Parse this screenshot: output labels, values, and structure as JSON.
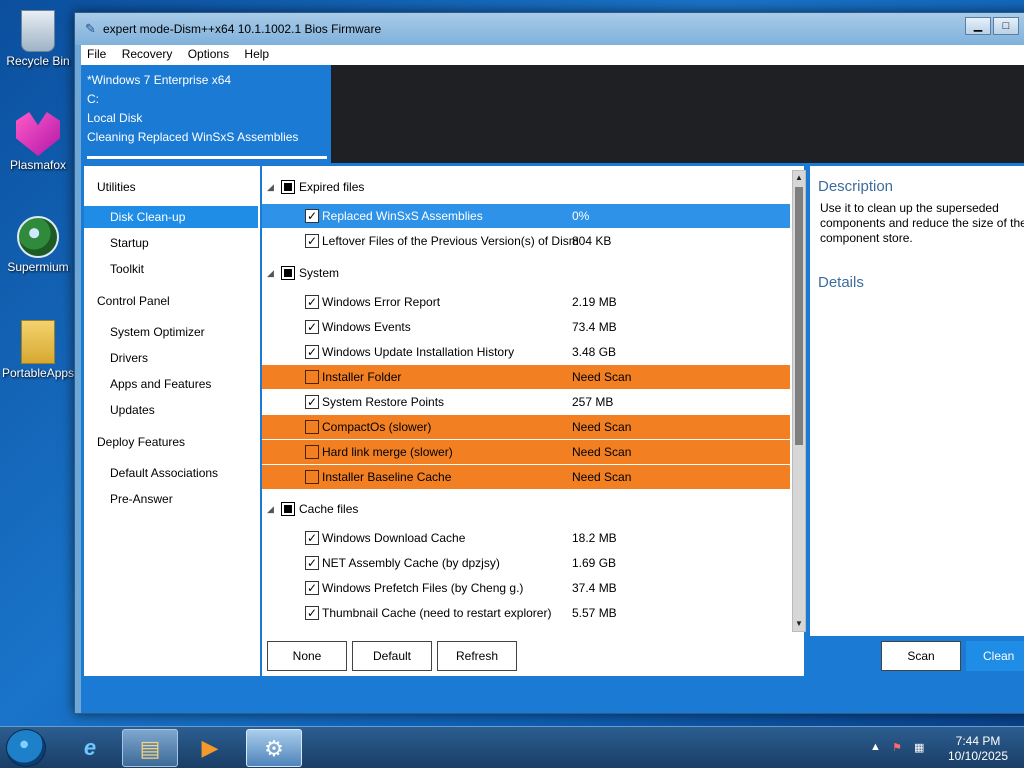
{
  "desktop": {
    "icons": [
      {
        "label": "Recycle Bin",
        "icon": "recycle-bin-icon"
      },
      {
        "label": "Plasmafox",
        "icon": "plasmafox-icon"
      },
      {
        "label": "Supermium",
        "icon": "supermium-icon"
      },
      {
        "label": "PortableApps",
        "icon": "folder-icon"
      }
    ]
  },
  "window": {
    "title": "expert mode-Dism++x64 10.1.1002.1 Bios Firmware",
    "menu": [
      "File",
      "Recovery",
      "Options",
      "Help"
    ]
  },
  "session": {
    "lines": [
      "*Windows 7 Enterprise x64",
      "C:",
      "Local Disk",
      "Cleaning Replaced WinSxS Assemblies"
    ]
  },
  "nav": {
    "categories": [
      {
        "label": "Utilities",
        "items": [
          "Disk Clean-up",
          "Startup",
          "Toolkit"
        ]
      },
      {
        "label": "Control Panel",
        "items": [
          "System Optimizer",
          "Drivers",
          "Apps and Features",
          "Updates"
        ]
      },
      {
        "label": "Deploy Features",
        "items": [
          "Default Associations",
          "Pre-Answer"
        ]
      }
    ],
    "active": "Disk Clean-up"
  },
  "list": {
    "groups": [
      {
        "label": "Expired files",
        "rows": [
          {
            "label": "Replaced WinSxS Assemblies",
            "size": "0%",
            "checked": true,
            "state": "selected"
          },
          {
            "label": "Leftover Files of the Previous Version(s) of Dism",
            "size": "804 KB",
            "checked": true,
            "state": "normal"
          }
        ]
      },
      {
        "label": "System",
        "rows": [
          {
            "label": "Windows Error Report",
            "size": "2.19 MB",
            "checked": true,
            "state": "normal"
          },
          {
            "label": "Windows Events",
            "size": "73.4 MB",
            "checked": true,
            "state": "normal"
          },
          {
            "label": "Windows Update Installation History",
            "size": "3.48 GB",
            "checked": true,
            "state": "normal"
          },
          {
            "label": "Installer Folder",
            "size": "Need Scan",
            "checked": false,
            "state": "warning"
          },
          {
            "label": "System Restore Points",
            "size": "257 MB",
            "checked": true,
            "state": "normal"
          },
          {
            "label": "CompactOs (slower)",
            "size": "Need Scan",
            "checked": false,
            "state": "warning"
          },
          {
            "label": "Hard link merge (slower)",
            "size": "Need Scan",
            "checked": false,
            "state": "warning"
          },
          {
            "label": "Installer Baseline Cache",
            "size": "Need Scan",
            "checked": false,
            "state": "warning"
          }
        ]
      },
      {
        "label": "Cache files",
        "rows": [
          {
            "label": "Windows Download Cache",
            "size": "18.2 MB",
            "checked": true,
            "state": "normal"
          },
          {
            "label": "NET Assembly Cache (by dpzjsy)",
            "size": "1.69 GB",
            "checked": true,
            "state": "normal"
          },
          {
            "label": "Windows Prefetch Files (by Cheng g.)",
            "size": "37.4 MB",
            "checked": true,
            "state": "normal"
          },
          {
            "label": "Thumbnail Cache (need to restart explorer)",
            "size": "5.57 MB",
            "checked": true,
            "state": "normal"
          }
        ]
      }
    ]
  },
  "buttons": {
    "none": "None",
    "default": "Default",
    "refresh": "Refresh",
    "scan": "Scan",
    "clean": "Clean Up"
  },
  "description": {
    "title": "Description",
    "text": "Use it to clean up the superseded components and reduce the size of the component store.",
    "details_title": "Details"
  },
  "taskbar": {
    "time": "7:44 PM",
    "date": "10/10/2025"
  },
  "colors": {
    "accent": "#1f8ce6",
    "warning_row": "#f27f22",
    "selected_row": "#2e92e8"
  }
}
